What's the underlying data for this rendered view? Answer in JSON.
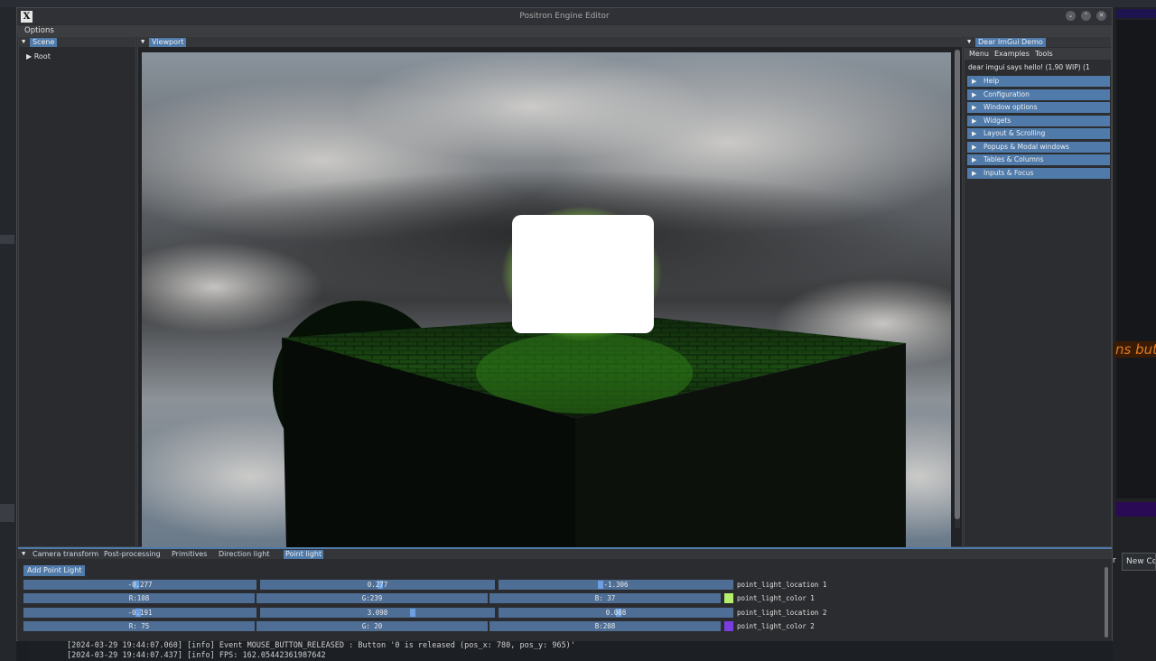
{
  "window": {
    "title": "Positron Engine Editor",
    "icon_glyph": "X",
    "buttons": {
      "minimize": "⌄",
      "maximize": "⌃",
      "close": "✕"
    }
  },
  "menubar": {
    "options_label": "Options"
  },
  "scene_panel": {
    "tab_label": "Scene",
    "tree": [
      {
        "label": "Root",
        "expanded": false
      }
    ]
  },
  "viewport_panel": {
    "tab_label": "Viewport"
  },
  "imgui_panel": {
    "tab_label": "Dear ImGui Demo",
    "menu": [
      "Menu",
      "Examples",
      "Tools"
    ],
    "hello_text": "dear imgui says hello! (1.90 WIP) (1",
    "headers": [
      "Help",
      "Configuration",
      "Window options",
      "Widgets",
      "Layout & Scrolling",
      "Popups & Modal windows",
      "Tables & Columns",
      "Inputs & Focus"
    ]
  },
  "bottom_panel": {
    "tabs": [
      {
        "label": "Camera transform",
        "active": false
      },
      {
        "label": "Post-processing",
        "active": false
      },
      {
        "label": "Primitives",
        "active": false
      },
      {
        "label": "Direction light",
        "active": false
      },
      {
        "label": "Point light",
        "active": true
      }
    ],
    "add_button_label": "Add Point Light",
    "rows": [
      {
        "label": "point_light_location 1",
        "fields": [
          "-0.277",
          "0.277",
          "-1.306"
        ]
      },
      {
        "label": "point_light_color 1",
        "fields": [
          "R:108",
          "G:239",
          "B: 37"
        ],
        "swatch": "#b4ef6e"
      },
      {
        "label": "point_light_location 2",
        "fields": [
          "-0.191",
          "3.098",
          "0.008"
        ]
      },
      {
        "label": "point_light_color 2",
        "fields": [
          "R: 75",
          "G: 20",
          "B:208"
        ],
        "swatch": "#7a3de0"
      }
    ]
  },
  "log": [
    "[2024-03-29 19:44:07.060] [info] Event MOUSE_BUTTON_RELEASED : Button '0 is released (pos_x: 780, pos_y: 965)'",
    "[2024-03-29 19:44:07.437] [info] FPS: 162.05442361987642"
  ],
  "background": {
    "orange_text": "ns but",
    "new_connection_label": "New Con",
    "r_label": "r"
  },
  "colors": {
    "accent": "#4f7aaa",
    "glow_cube": "#9bff3a",
    "window_bg": "#2b2d30"
  }
}
